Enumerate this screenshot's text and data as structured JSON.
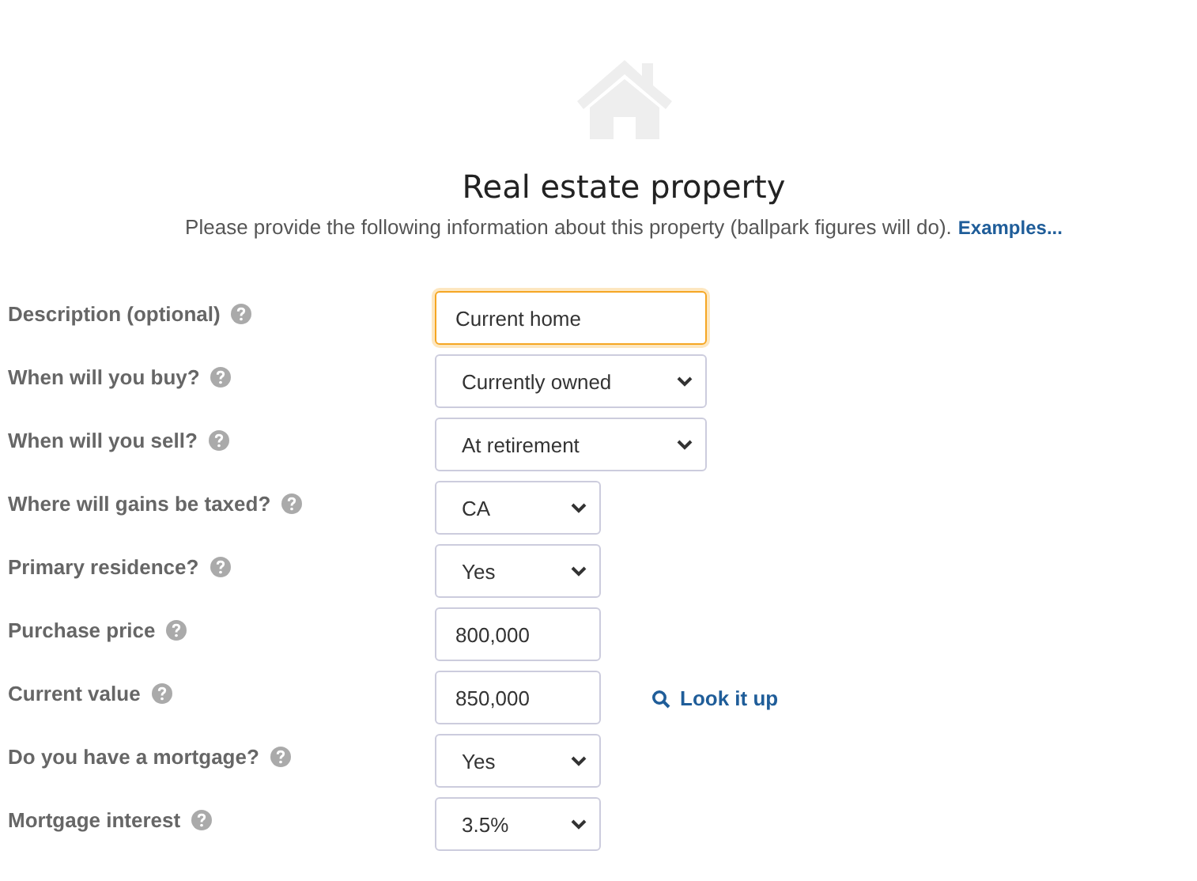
{
  "header": {
    "title": "Real estate property",
    "intro": "Please provide the following information about this property (ballpark figures will do).",
    "link": "Examples..."
  },
  "fields": [
    {
      "label": "Description (optional)",
      "kind": "text",
      "value": "Current home",
      "focused": true
    },
    {
      "label": "When will you buy?",
      "kind": "select",
      "value": "Currently owned",
      "focused": false
    },
    {
      "label": "When will you sell?",
      "kind": "select",
      "value": "At retirement",
      "focused": false
    },
    {
      "label": "Where will gains be taxed?",
      "kind": "select",
      "value": "CA",
      "focused": false
    },
    {
      "label": "Primary residence?",
      "kind": "select",
      "value": "Yes",
      "focused": false
    },
    {
      "label": "Purchase price",
      "kind": "text",
      "value": "800,000",
      "focused": false
    },
    {
      "label": "Current value",
      "kind": "text",
      "value": "850,000",
      "focused": false,
      "action": "Look it up"
    },
    {
      "label": "Do you have a mortgage?",
      "kind": "select",
      "value": "Yes",
      "focused": false
    },
    {
      "label": "Mortgage interest",
      "kind": "select",
      "value": "3.5%",
      "focused": false
    }
  ]
}
